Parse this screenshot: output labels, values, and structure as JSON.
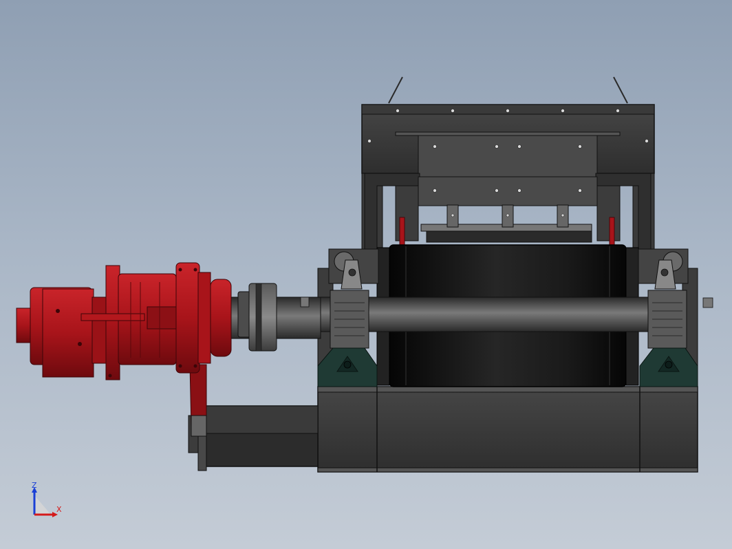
{
  "viewport": {
    "background_top": "#8f9fb3",
    "background_bottom": "#c4ccd6"
  },
  "model": {
    "components": [
      "gear-motor",
      "drive-coupling",
      "drive-shaft",
      "drum-pulley",
      "bearing-housing-left",
      "bearing-housing-right",
      "hopper-frame",
      "base-frame",
      "torque-arm",
      "motor-support-beam"
    ],
    "colors": {
      "motor": "#a8141a",
      "drum": "#161616",
      "frame": "#3a3a3a",
      "bearing_base": "#1f3a34"
    }
  },
  "triad": {
    "z_label": "Z",
    "x_label": "X",
    "z_color": "#1a3fd6",
    "x_color": "#d41a1a"
  }
}
